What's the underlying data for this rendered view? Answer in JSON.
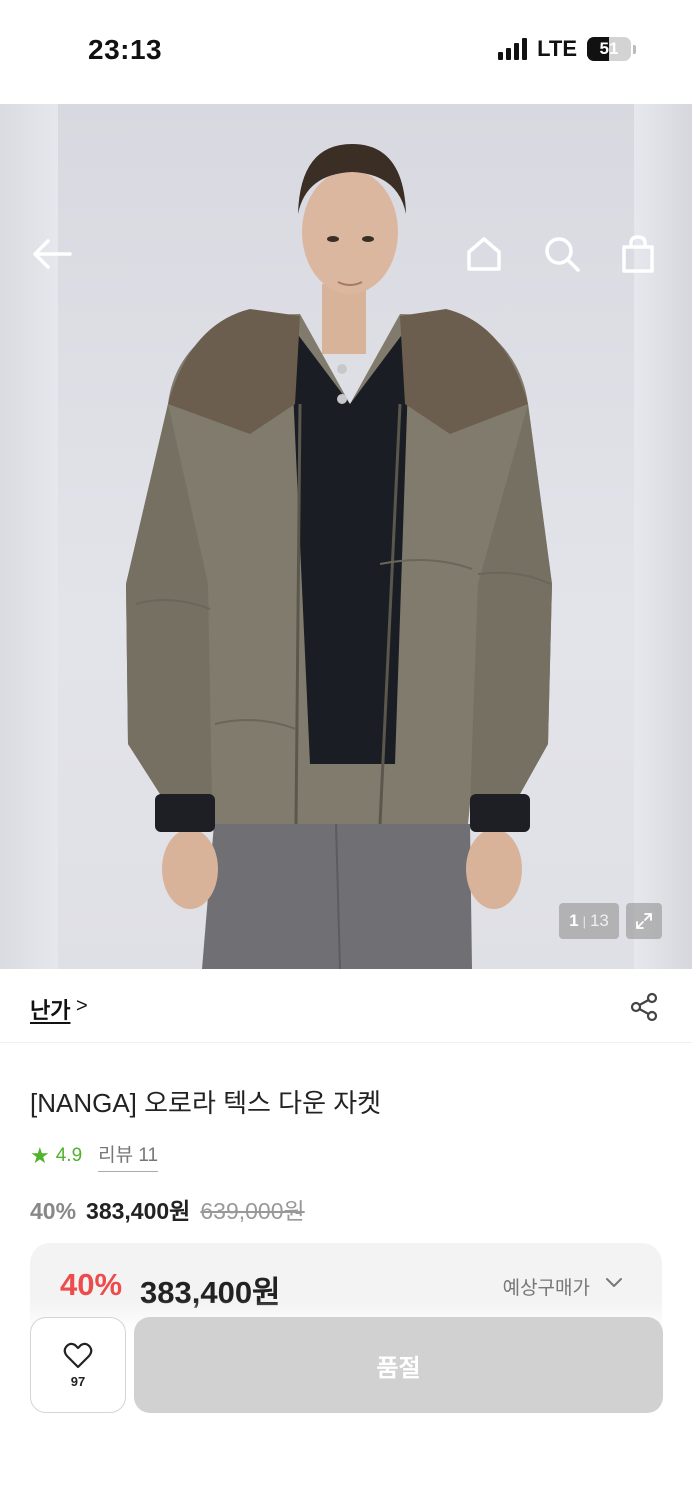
{
  "status_bar": {
    "time": "23:13",
    "network": "LTE",
    "battery": "51",
    "battery_level": 0.51
  },
  "hero": {
    "image_counter": {
      "current": "1",
      "separator": "|",
      "total": "13"
    },
    "icons": {
      "back": "back-arrow-icon",
      "home": "home-icon",
      "search": "search-icon",
      "cart": "shopping-bag-icon",
      "expand": "expand-icon"
    }
  },
  "brand": {
    "name": "난가",
    "chevron": ">"
  },
  "product": {
    "title": "[NANGA] 오로라 텍스 다운 자켓",
    "rating": "4.9",
    "review_label": "리뷰 11",
    "price": {
      "discount": "40%",
      "sale": "383,400원",
      "original": "639,000원"
    }
  },
  "expected_price": {
    "discount": "40%",
    "price": "383,400원",
    "label": "예상구매가"
  },
  "actions": {
    "like_count": "97",
    "primary_label": "품절"
  },
  "colors": {
    "rating_green": "#4fb32b",
    "discount_red": "#ee4b4b",
    "soldout_gray": "#d1d1d1"
  }
}
